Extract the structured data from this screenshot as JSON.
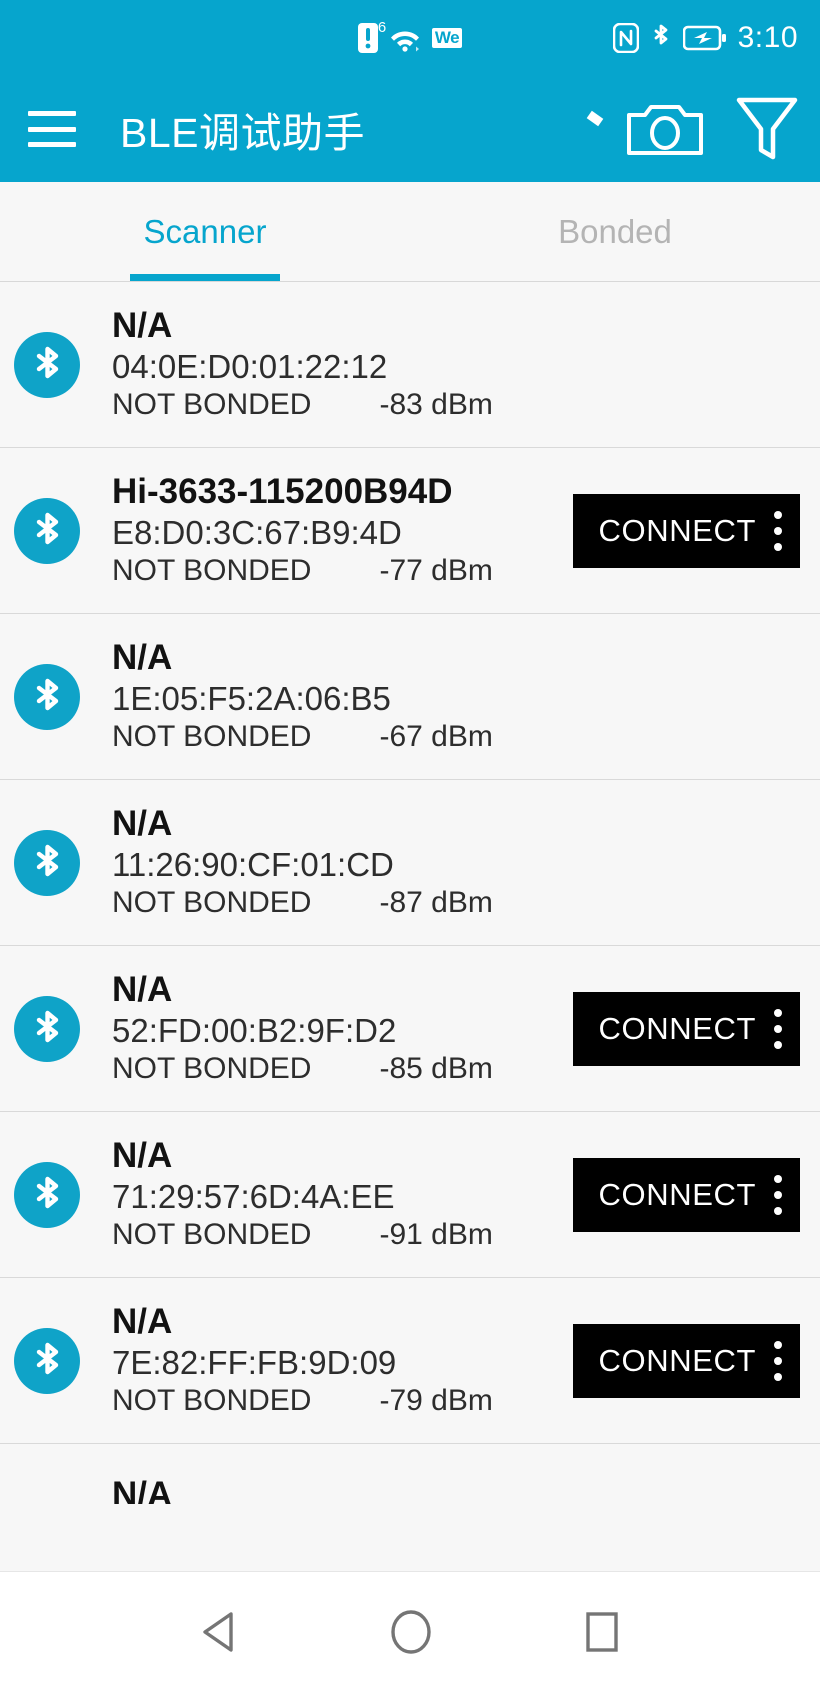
{
  "status_bar": {
    "time": "3:10",
    "wifi_label": "6",
    "we_badge": "We",
    "icons": [
      "sim-alert-icon",
      "wifi-icon",
      "wechat-icon",
      "nfc-icon",
      "bluetooth-icon",
      "battery-charging-icon"
    ]
  },
  "app_bar": {
    "menu_icon": "hamburger-menu-icon",
    "title": "BLE调试助手",
    "camera_icon": "camera-icon",
    "filter_icon": "filter-icon"
  },
  "tabs": [
    {
      "label": "Scanner",
      "active": true
    },
    {
      "label": "Bonded",
      "active": false
    }
  ],
  "colors": {
    "accent": "#06a5cd",
    "bt_icon_bg": "#0fa3c8",
    "tab_inactive": "#b4b4b4",
    "connect_bg": "#000000",
    "annotation_arrow": "#d32020",
    "page_bg": "#f7f7f7"
  },
  "labels": {
    "connect": "CONNECT",
    "not_bonded": "NOT BONDED",
    "overflow_icon": "kebab-menu-icon",
    "bluetooth_icon": "bluetooth-icon"
  },
  "devices": [
    {
      "name": "N/A",
      "address": "04:0E:D0:01:22:12",
      "bond_state": "NOT BONDED",
      "rssi": "-83 dBm",
      "has_connect": false,
      "annotated": true
    },
    {
      "name": "Hi-3633-115200B94D",
      "address": "E8:D0:3C:67:B9:4D",
      "bond_state": "NOT BONDED",
      "rssi": "-77 dBm",
      "has_connect": true,
      "annotated": true
    },
    {
      "name": "N/A",
      "address": "1E:05:F5:2A:06:B5",
      "bond_state": "NOT BONDED",
      "rssi": "-67 dBm",
      "has_connect": false,
      "annotated": true
    },
    {
      "name": "N/A",
      "address": "11:26:90:CF:01:CD",
      "bond_state": "NOT BONDED",
      "rssi": "-87 dBm",
      "has_connect": false,
      "annotated": false
    },
    {
      "name": "N/A",
      "address": "52:FD:00:B2:9F:D2",
      "bond_state": "NOT BONDED",
      "rssi": "-85 dBm",
      "has_connect": true,
      "annotated": false
    },
    {
      "name": "N/A",
      "address": "71:29:57:6D:4A:EE",
      "bond_state": "NOT BONDED",
      "rssi": "-91 dBm",
      "has_connect": true,
      "annotated": false
    },
    {
      "name": "N/A",
      "address": "7E:82:FF:FB:9D:09",
      "bond_state": "NOT BONDED",
      "rssi": "-79 dBm",
      "has_connect": true,
      "annotated": false
    },
    {
      "name": "N/A",
      "address": "",
      "bond_state": "",
      "rssi": "",
      "has_connect": false,
      "annotated": false,
      "clipped": true
    }
  ],
  "nav_bar": {
    "back_icon": "back-triangle-icon",
    "home_icon": "home-circle-icon",
    "recents_icon": "recents-square-icon"
  }
}
